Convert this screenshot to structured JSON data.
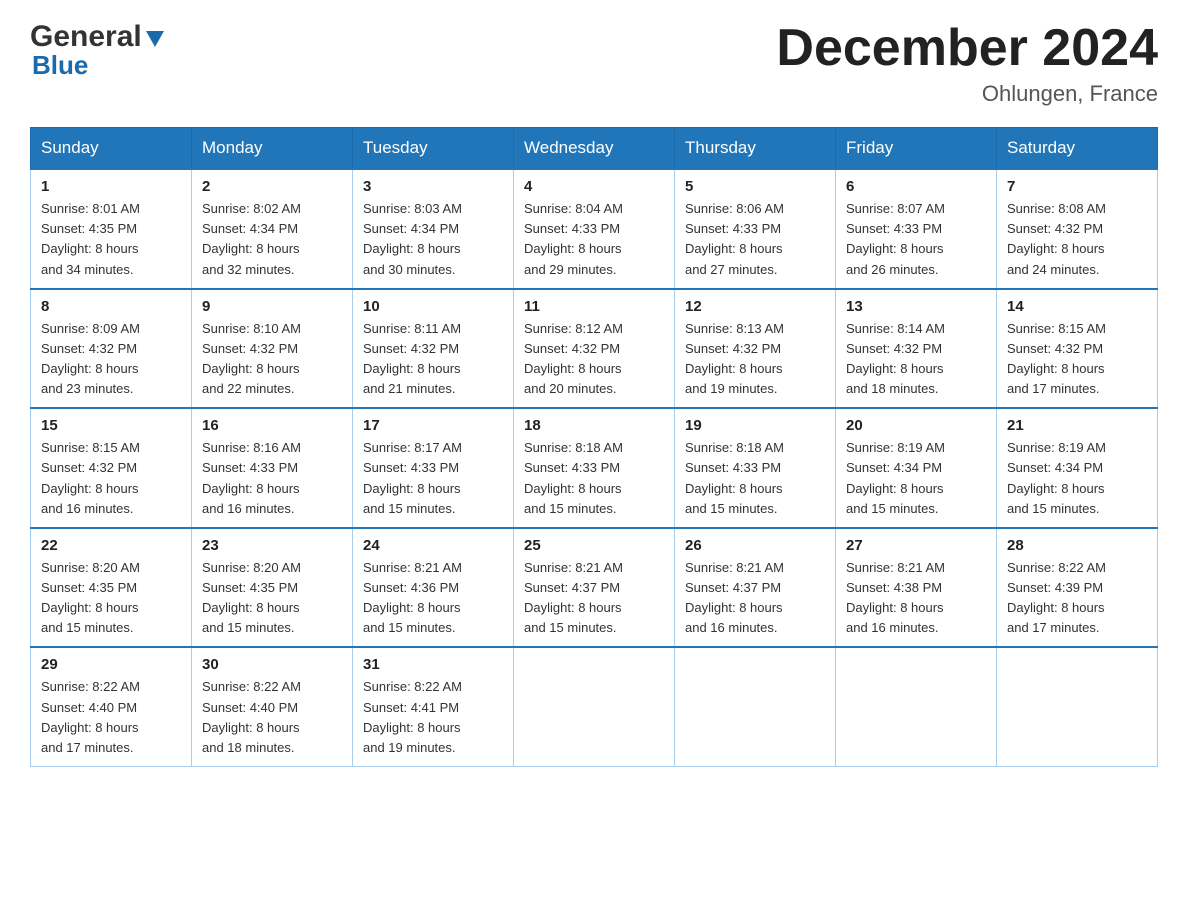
{
  "header": {
    "logo_general": "General",
    "logo_blue": "Blue",
    "month_title": "December 2024",
    "location": "Ohlungen, France"
  },
  "weekdays": [
    "Sunday",
    "Monday",
    "Tuesday",
    "Wednesday",
    "Thursday",
    "Friday",
    "Saturday"
  ],
  "weeks": [
    [
      {
        "day": "1",
        "sunrise": "8:01 AM",
        "sunset": "4:35 PM",
        "daylight": "8 hours and 34 minutes."
      },
      {
        "day": "2",
        "sunrise": "8:02 AM",
        "sunset": "4:34 PM",
        "daylight": "8 hours and 32 minutes."
      },
      {
        "day": "3",
        "sunrise": "8:03 AM",
        "sunset": "4:34 PM",
        "daylight": "8 hours and 30 minutes."
      },
      {
        "day": "4",
        "sunrise": "8:04 AM",
        "sunset": "4:33 PM",
        "daylight": "8 hours and 29 minutes."
      },
      {
        "day": "5",
        "sunrise": "8:06 AM",
        "sunset": "4:33 PM",
        "daylight": "8 hours and 27 minutes."
      },
      {
        "day": "6",
        "sunrise": "8:07 AM",
        "sunset": "4:33 PM",
        "daylight": "8 hours and 26 minutes."
      },
      {
        "day": "7",
        "sunrise": "8:08 AM",
        "sunset": "4:32 PM",
        "daylight": "8 hours and 24 minutes."
      }
    ],
    [
      {
        "day": "8",
        "sunrise": "8:09 AM",
        "sunset": "4:32 PM",
        "daylight": "8 hours and 23 minutes."
      },
      {
        "day": "9",
        "sunrise": "8:10 AM",
        "sunset": "4:32 PM",
        "daylight": "8 hours and 22 minutes."
      },
      {
        "day": "10",
        "sunrise": "8:11 AM",
        "sunset": "4:32 PM",
        "daylight": "8 hours and 21 minutes."
      },
      {
        "day": "11",
        "sunrise": "8:12 AM",
        "sunset": "4:32 PM",
        "daylight": "8 hours and 20 minutes."
      },
      {
        "day": "12",
        "sunrise": "8:13 AM",
        "sunset": "4:32 PM",
        "daylight": "8 hours and 19 minutes."
      },
      {
        "day": "13",
        "sunrise": "8:14 AM",
        "sunset": "4:32 PM",
        "daylight": "8 hours and 18 minutes."
      },
      {
        "day": "14",
        "sunrise": "8:15 AM",
        "sunset": "4:32 PM",
        "daylight": "8 hours and 17 minutes."
      }
    ],
    [
      {
        "day": "15",
        "sunrise": "8:15 AM",
        "sunset": "4:32 PM",
        "daylight": "8 hours and 16 minutes."
      },
      {
        "day": "16",
        "sunrise": "8:16 AM",
        "sunset": "4:33 PM",
        "daylight": "8 hours and 16 minutes."
      },
      {
        "day": "17",
        "sunrise": "8:17 AM",
        "sunset": "4:33 PM",
        "daylight": "8 hours and 15 minutes."
      },
      {
        "day": "18",
        "sunrise": "8:18 AM",
        "sunset": "4:33 PM",
        "daylight": "8 hours and 15 minutes."
      },
      {
        "day": "19",
        "sunrise": "8:18 AM",
        "sunset": "4:33 PM",
        "daylight": "8 hours and 15 minutes."
      },
      {
        "day": "20",
        "sunrise": "8:19 AM",
        "sunset": "4:34 PM",
        "daylight": "8 hours and 15 minutes."
      },
      {
        "day": "21",
        "sunrise": "8:19 AM",
        "sunset": "4:34 PM",
        "daylight": "8 hours and 15 minutes."
      }
    ],
    [
      {
        "day": "22",
        "sunrise": "8:20 AM",
        "sunset": "4:35 PM",
        "daylight": "8 hours and 15 minutes."
      },
      {
        "day": "23",
        "sunrise": "8:20 AM",
        "sunset": "4:35 PM",
        "daylight": "8 hours and 15 minutes."
      },
      {
        "day": "24",
        "sunrise": "8:21 AM",
        "sunset": "4:36 PM",
        "daylight": "8 hours and 15 minutes."
      },
      {
        "day": "25",
        "sunrise": "8:21 AM",
        "sunset": "4:37 PM",
        "daylight": "8 hours and 15 minutes."
      },
      {
        "day": "26",
        "sunrise": "8:21 AM",
        "sunset": "4:37 PM",
        "daylight": "8 hours and 16 minutes."
      },
      {
        "day": "27",
        "sunrise": "8:21 AM",
        "sunset": "4:38 PM",
        "daylight": "8 hours and 16 minutes."
      },
      {
        "day": "28",
        "sunrise": "8:22 AM",
        "sunset": "4:39 PM",
        "daylight": "8 hours and 17 minutes."
      }
    ],
    [
      {
        "day": "29",
        "sunrise": "8:22 AM",
        "sunset": "4:40 PM",
        "daylight": "8 hours and 17 minutes."
      },
      {
        "day": "30",
        "sunrise": "8:22 AM",
        "sunset": "4:40 PM",
        "daylight": "8 hours and 18 minutes."
      },
      {
        "day": "31",
        "sunrise": "8:22 AM",
        "sunset": "4:41 PM",
        "daylight": "8 hours and 19 minutes."
      },
      null,
      null,
      null,
      null
    ]
  ],
  "labels": {
    "sunrise": "Sunrise:",
    "sunset": "Sunset:",
    "daylight": "Daylight:"
  }
}
